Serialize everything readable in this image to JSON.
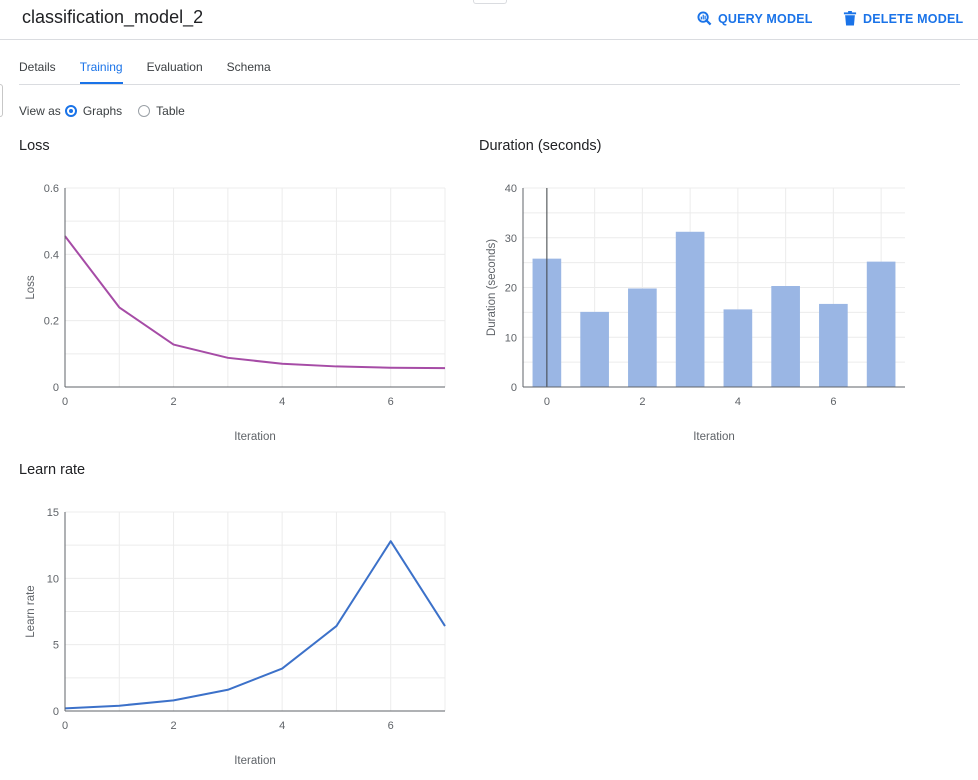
{
  "page": {
    "title": "classification_model_2"
  },
  "actions": {
    "query_label": "QUERY MODEL",
    "delete_label": "DELETE MODEL"
  },
  "tabs": [
    {
      "label": "Details",
      "active": false
    },
    {
      "label": "Training",
      "active": true
    },
    {
      "label": "Evaluation",
      "active": false
    },
    {
      "label": "Schema",
      "active": false
    }
  ],
  "view_as": {
    "label": "View as",
    "options": [
      "Graphs",
      "Table"
    ],
    "selected": "Graphs"
  },
  "colors": {
    "accent": "#1a73e8",
    "loss_line": "#a64ca6",
    "bar_fill": "#9ab6e4",
    "lr_line": "#3c71c9"
  },
  "chart_data": [
    {
      "type": "line",
      "title": "Loss",
      "xlabel": "Iteration",
      "ylabel": "Loss",
      "x": [
        0,
        1,
        2,
        3,
        4,
        5,
        6,
        7
      ],
      "series": [
        {
          "values": [
            0.455,
            0.24,
            0.128,
            0.088,
            0.07,
            0.062,
            0.058,
            0.057
          ]
        }
      ],
      "xlim": [
        0,
        7
      ],
      "ylim": [
        0,
        0.6
      ],
      "xticks": [
        0,
        2,
        4,
        6
      ],
      "xtick_labels": [
        "0",
        "2",
        "4",
        "6"
      ],
      "yticks": [
        0,
        0.2,
        0.4,
        0.6
      ],
      "ytick_labels": [
        "0",
        "0.2",
        "0.4",
        "0.6"
      ],
      "grid": true
    },
    {
      "type": "bar",
      "title": "Duration (seconds)",
      "xlabel": "Iteration",
      "ylabel": "Duration (seconds)",
      "x": [
        0,
        1,
        2,
        3,
        4,
        5,
        6,
        7
      ],
      "values": [
        25.8,
        15.1,
        19.8,
        31.2,
        15.6,
        20.3,
        16.7,
        25.2
      ],
      "xlim": [
        -0.5,
        7.5
      ],
      "ylim": [
        0,
        40
      ],
      "xticks": [
        0,
        2,
        4,
        6
      ],
      "xtick_labels": [
        "0",
        "2",
        "4",
        "6"
      ],
      "yticks": [
        0,
        10,
        20,
        30,
        40
      ],
      "ytick_labels": [
        "0",
        "10",
        "20",
        "30",
        "40"
      ],
      "grid": true
    },
    {
      "type": "line",
      "title": "Learn rate",
      "xlabel": "Iteration",
      "ylabel": "Learn rate",
      "x": [
        0,
        1,
        2,
        3,
        4,
        5,
        6,
        7
      ],
      "series": [
        {
          "values": [
            0.2,
            0.4,
            0.8,
            1.6,
            3.2,
            6.4,
            12.8,
            6.4
          ]
        }
      ],
      "xlim": [
        0,
        7
      ],
      "ylim": [
        0,
        15
      ],
      "xticks": [
        0,
        2,
        4,
        6
      ],
      "xtick_labels": [
        "0",
        "2",
        "4",
        "6"
      ],
      "yticks": [
        0,
        5,
        10,
        15
      ],
      "ytick_labels": [
        "0",
        "5",
        "10",
        "15"
      ],
      "grid": true
    }
  ]
}
